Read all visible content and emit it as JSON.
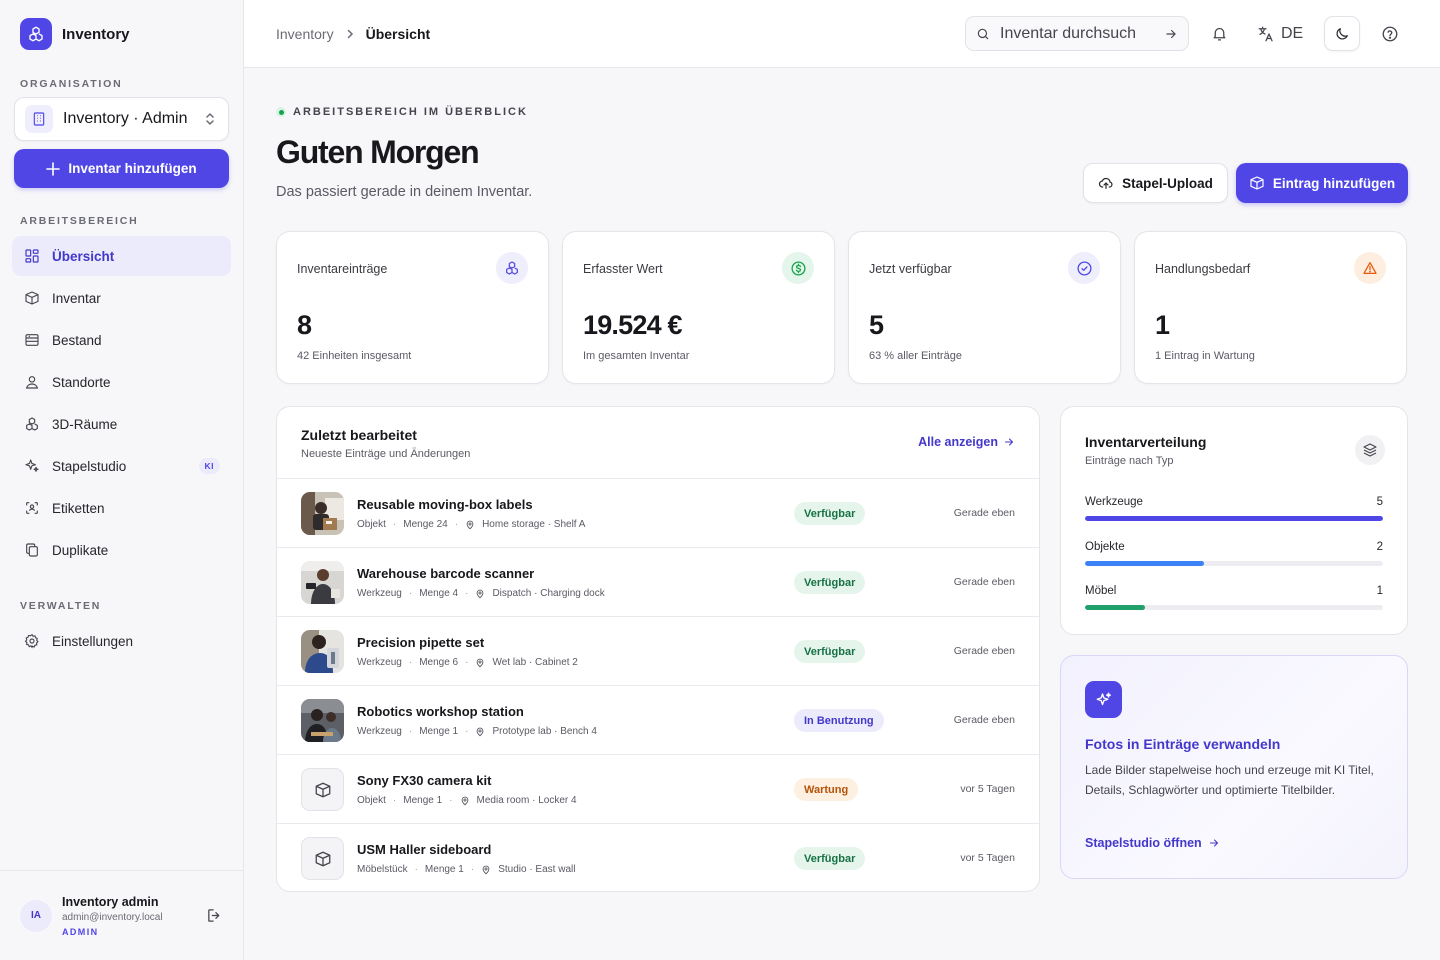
{
  "app": {
    "name": "Inventory"
  },
  "sidebar": {
    "org_label": "ORGANISATION",
    "org_name": "Inventory · Admin",
    "add_label": "Inventar hinzufügen",
    "workspace_label": "ARBEITSBEREICH",
    "items": [
      {
        "label": "Übersicht",
        "icon": "grid-icon",
        "active": true
      },
      {
        "label": "Inventar",
        "icon": "box-icon"
      },
      {
        "label": "Bestand",
        "icon": "stack-icon"
      },
      {
        "label": "Standorte",
        "icon": "map-pin-icon"
      },
      {
        "label": "3D-Räume",
        "icon": "cubes-icon"
      },
      {
        "label": "Stapelstudio",
        "icon": "sparkle-icon",
        "badge": "KI"
      },
      {
        "label": "Etiketten",
        "icon": "scan-icon"
      },
      {
        "label": "Duplikate",
        "icon": "copy-icon"
      }
    ],
    "manage_label": "VERWALTEN",
    "manage_items": [
      {
        "label": "Einstellungen",
        "icon": "gear-icon"
      }
    ],
    "user": {
      "initials": "IA",
      "name": "Inventory admin",
      "email": "admin@inventory.local",
      "role": "ADMIN"
    }
  },
  "topbar": {
    "breadcrumb": [
      "Inventory",
      "Übersicht"
    ],
    "search_placeholder": "Inventar durchsuchen",
    "language": "DE"
  },
  "header": {
    "eyebrow": "ARBEITSBEREICH IM ÜBERBLICK",
    "title": "Guten Morgen",
    "subtitle": "Das passiert gerade in deinem Inventar.",
    "batch_upload": "Stapel-Upload",
    "add_entry": "Eintrag hinzufügen"
  },
  "stats": [
    {
      "label": "Inventareinträge",
      "value": "8",
      "note": "42 Einheiten insgesamt",
      "icon": "cubes-icon",
      "color": "#4f46e5",
      "bg": "#eeeefc"
    },
    {
      "label": "Erfasster Wert",
      "value": "19.524 €",
      "note": "Im gesamten Inventar",
      "icon": "dollar-icon",
      "color": "#16a34a",
      "bg": "#e4f5eb"
    },
    {
      "label": "Jetzt verfügbar",
      "value": "5",
      "note": "63 % aller Einträge",
      "icon": "check-circle-icon",
      "color": "#4f46e5",
      "bg": "#eeeefc"
    },
    {
      "label": "Handlungsbedarf",
      "value": "1",
      "note": "1 Eintrag in Wartung",
      "icon": "warning-icon",
      "color": "#ea580c",
      "bg": "#fdeee0"
    }
  ],
  "recent": {
    "title": "Zuletzt bearbeitet",
    "subtitle": "Neueste Einträge und Änderungen",
    "link": "Alle anzeigen",
    "rows": [
      {
        "name": "Reusable moving-box labels",
        "type": "Objekt",
        "qty": "Menge 24",
        "location": "Home storage · Shelf A",
        "status": "Verfügbar",
        "status_kind": "green",
        "time": "Gerade eben",
        "thumb": "photo"
      },
      {
        "name": "Warehouse barcode scanner",
        "type": "Werkzeug",
        "qty": "Menge 4",
        "location": "Dispatch · Charging dock",
        "status": "Verfügbar",
        "status_kind": "green",
        "time": "Gerade eben",
        "thumb": "photo"
      },
      {
        "name": "Precision pipette set",
        "type": "Werkzeug",
        "qty": "Menge 6",
        "location": "Wet lab · Cabinet 2",
        "status": "Verfügbar",
        "status_kind": "green",
        "time": "Gerade eben",
        "thumb": "photo"
      },
      {
        "name": "Robotics workshop station",
        "type": "Werkzeug",
        "qty": "Menge 1",
        "location": "Prototype lab · Bench 4",
        "status": "In Benutzung",
        "status_kind": "indigo",
        "time": "Gerade eben",
        "thumb": "photo"
      },
      {
        "name": "Sony FX30 camera kit",
        "type": "Objekt",
        "qty": "Menge 1",
        "location": "Media room · Locker 4",
        "status": "Wartung",
        "status_kind": "orange",
        "time": "vor 5 Tagen",
        "thumb": "box"
      },
      {
        "name": "USM Haller sideboard",
        "type": "Möbelstück",
        "qty": "Menge 1",
        "location": "Studio · East wall",
        "status": "Verfügbar",
        "status_kind": "green",
        "time": "vor 5 Tagen",
        "thumb": "box"
      }
    ]
  },
  "distribution": {
    "title": "Inventarverteilung",
    "subtitle": "Einträge nach Typ",
    "max": 5,
    "bars": [
      {
        "label": "Werkzeuge",
        "value": 5,
        "color": "#4f46e5"
      },
      {
        "label": "Objekte",
        "value": 2,
        "color": "#3b82f6"
      },
      {
        "label": "Möbel",
        "value": 1,
        "color": "#22a06b"
      }
    ]
  },
  "promo": {
    "title": "Fotos in Einträge verwandeln",
    "text": "Lade Bilder stapelweise hoch und erzeuge mit KI Titel, Details, Schlagwörter und optimierte Titelbilder.",
    "link": "Stapelstudio öffnen"
  }
}
